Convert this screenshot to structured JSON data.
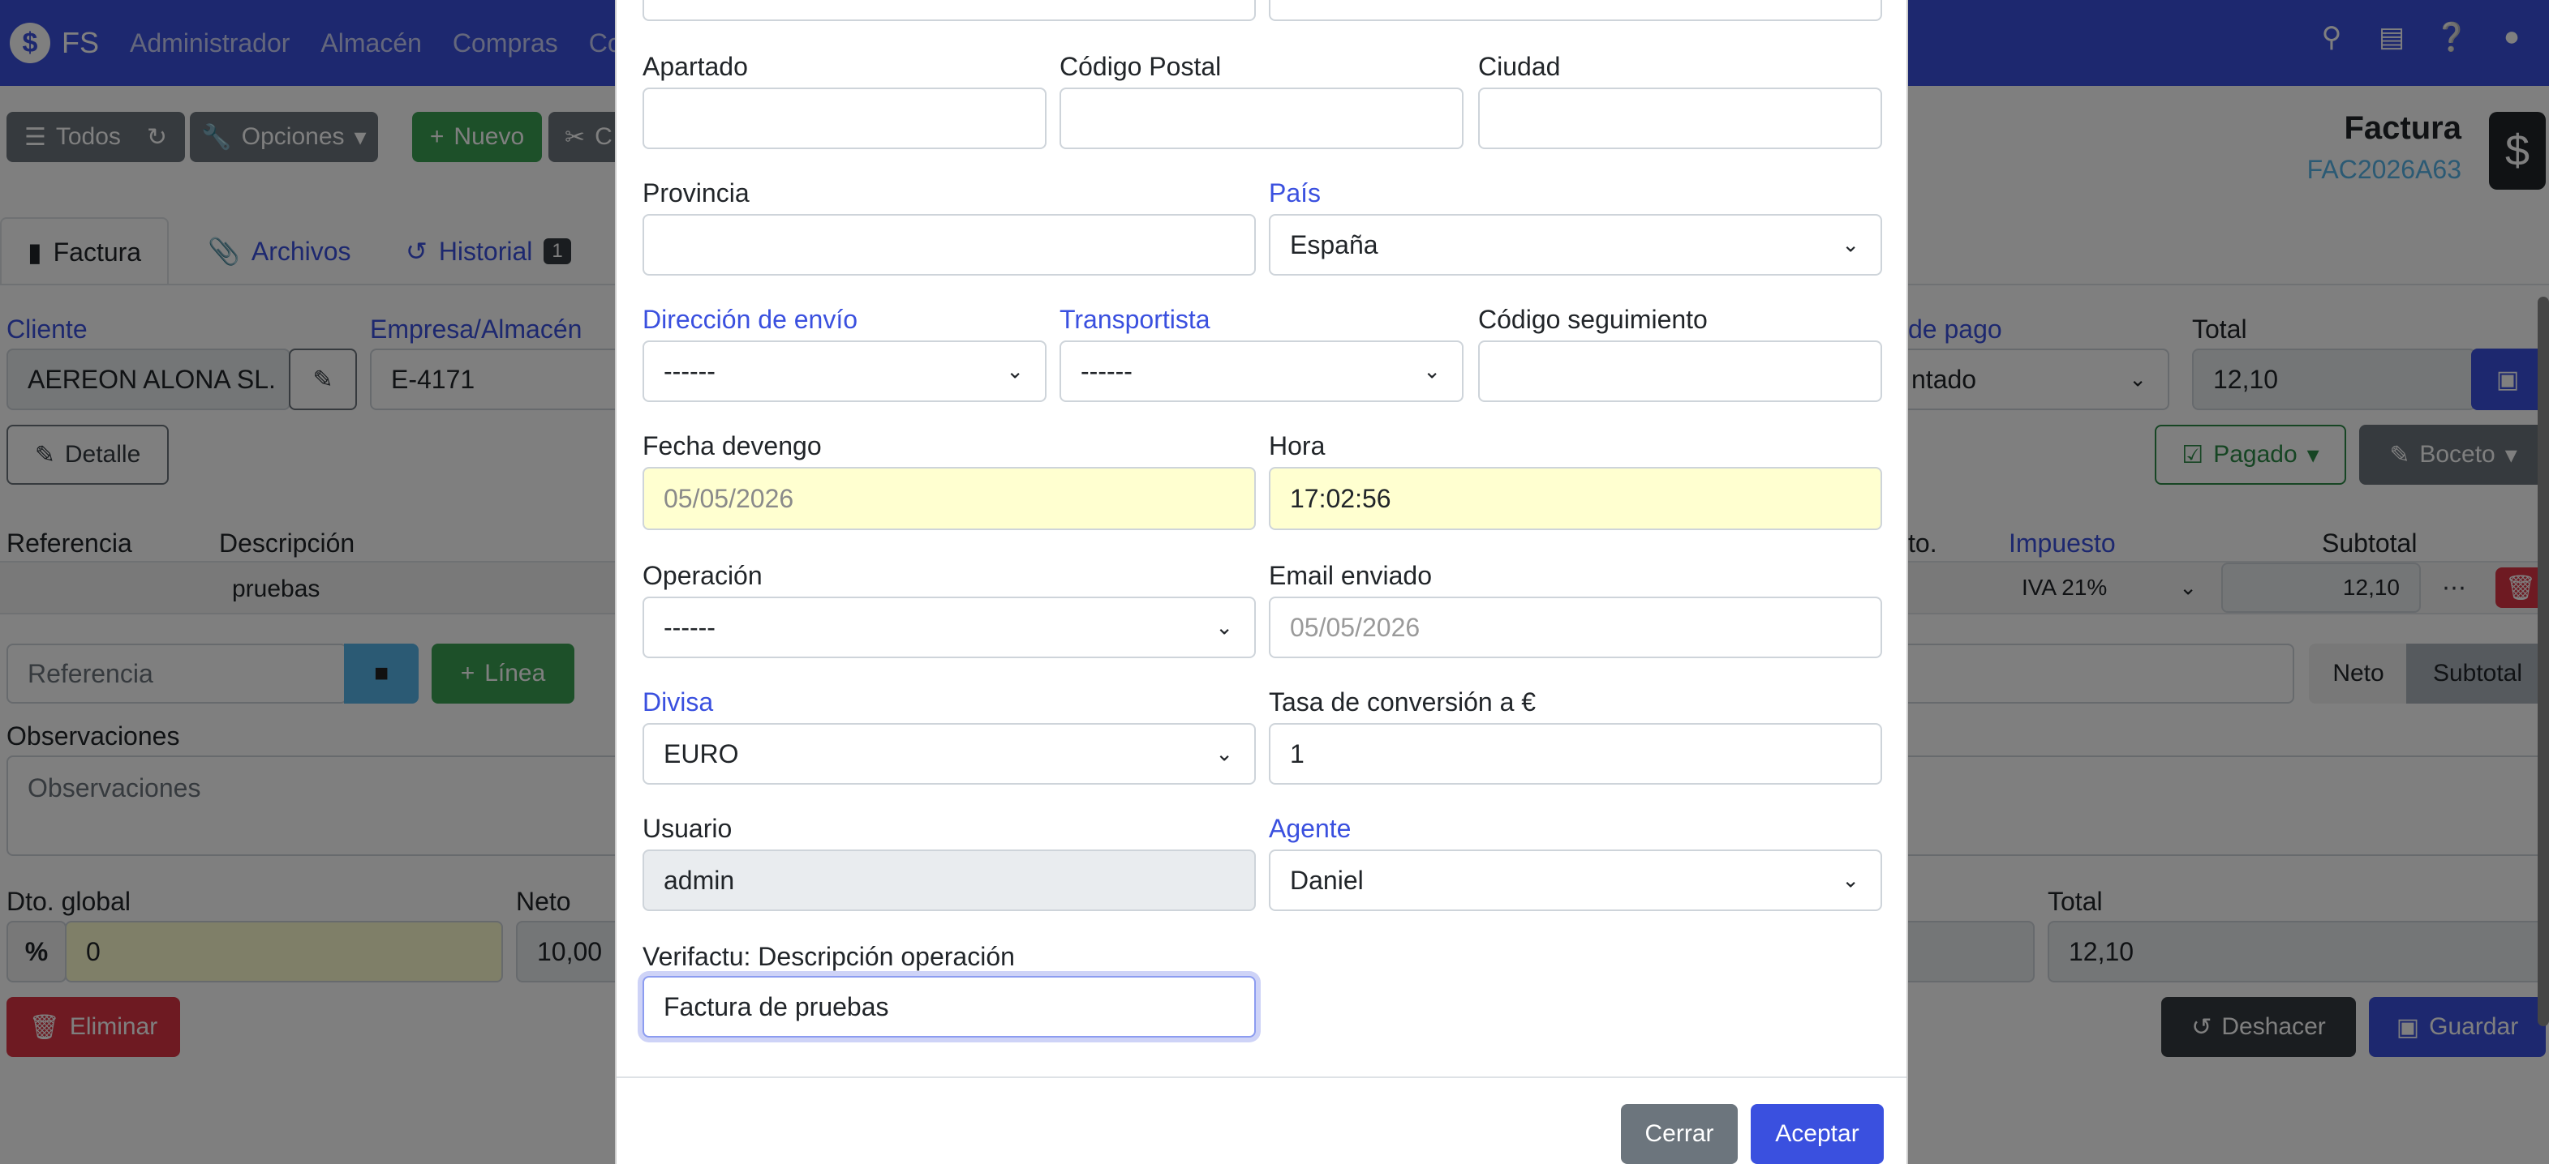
{
  "navbar": {
    "brand": "FS",
    "items": [
      "Administrador",
      "Almacén",
      "Compras",
      "Co"
    ],
    "icons": [
      "search-icon",
      "broadcast-icon",
      "help-icon",
      "user-icon"
    ]
  },
  "toolbar": {
    "todos": "Todos",
    "opciones": "Opciones",
    "nuevo": "Nuevo",
    "cortar": "C"
  },
  "document": {
    "type": "Factura",
    "code": "FAC2026A63"
  },
  "tabs": [
    {
      "label": "Factura"
    },
    {
      "label": "Archivos"
    },
    {
      "label": "Historial",
      "badge": "1"
    }
  ],
  "header_fields": {
    "cliente_label": "Cliente",
    "cliente_value": "AEREON ALONA SL.",
    "empresa_label": "Empresa/Almacén",
    "empresa_value": "E-4171",
    "pago_label": "de pago",
    "pago_value": "ntado",
    "total_label": "Total",
    "total_value": "12,10"
  },
  "actions": {
    "detalle": "Detalle",
    "pagado": "Pagado",
    "boceto": "Boceto"
  },
  "lines_table": {
    "col_referencia": "Referencia",
    "col_descripcion": "Descripción",
    "col_dto": "to.",
    "col_impuesto": "Impuesto",
    "col_subtotal": "Subtotal",
    "row_descripcion": "pruebas",
    "row_impuesto": "IVA 21%",
    "row_subtotal": "12,10"
  },
  "add_line": {
    "referencia_placeholder": "Referencia",
    "linea": "Línea",
    "neto": "Neto",
    "subtotal": "Subtotal"
  },
  "observaciones": {
    "label": "Observaciones",
    "placeholder": "Observaciones"
  },
  "totals": {
    "dto_label": "Dto. global",
    "dto_value": "0",
    "neto_label": "Neto",
    "neto_value": "10,00",
    "total_label": "Total",
    "total_value": "12,10"
  },
  "bottom_actions": {
    "eliminar": "Eliminar",
    "deshacer": "Deshacer",
    "guardar": "Guardar"
  },
  "modal": {
    "apartado_label": "Apartado",
    "codigo_postal_label": "Código Postal",
    "ciudad_label": "Ciudad",
    "provincia_label": "Provincia",
    "pais_label": "País",
    "pais_value": "España",
    "direccion_envio_label": "Dirección de envío",
    "direccion_envio_value": "------",
    "transportista_label": "Transportista",
    "transportista_value": "------",
    "codigo_seguimiento_label": "Código seguimiento",
    "fecha_devengo_label": "Fecha devengo",
    "fecha_devengo_value": "05/05/2026",
    "hora_label": "Hora",
    "hora_value": "17:02:56",
    "operacion_label": "Operación",
    "operacion_value": "------",
    "email_enviado_label": "Email enviado",
    "email_enviado_value": "05/05/2026",
    "divisa_label": "Divisa",
    "divisa_value": "EURO",
    "tasa_label": "Tasa de conversión a €",
    "tasa_value": "1",
    "usuario_label": "Usuario",
    "usuario_value": "admin",
    "agente_label": "Agente",
    "agente_value": "Daniel",
    "verifactu_label": "Verifactu: Descripción operación",
    "verifactu_value": "Factura de pruebas",
    "cerrar": "Cerrar",
    "aceptar": "Aceptar"
  }
}
